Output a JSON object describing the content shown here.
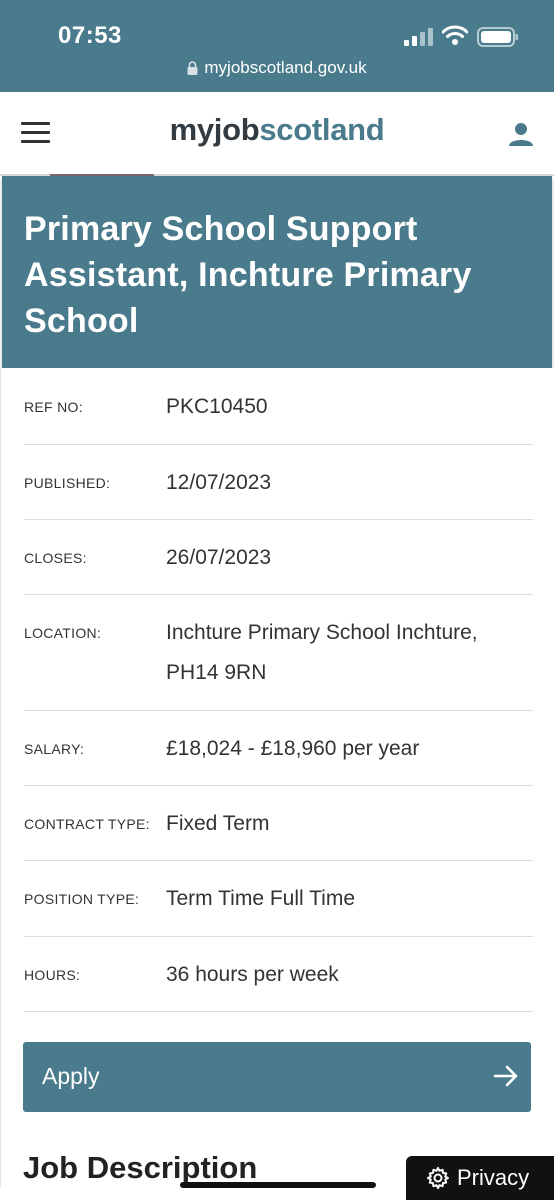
{
  "status_bar": {
    "time": "07:53"
  },
  "browser": {
    "url": "myjobscotland.gov.uk"
  },
  "header": {
    "logo_part1": "myjob",
    "logo_part2": "scotland"
  },
  "job": {
    "title": "Primary School Support Assistant, Inchture Primary School",
    "details": [
      {
        "label": "REF NO:",
        "value": "PKC10450"
      },
      {
        "label": "PUBLISHED:",
        "value": "12/07/2023"
      },
      {
        "label": "CLOSES:",
        "value": "26/07/2023"
      },
      {
        "label": "LOCATION:",
        "value_line1": "Inchture Primary School Inchture,",
        "value_line2": "PH14 9RN"
      },
      {
        "label": "SALARY:",
        "value": "£18,024 - £18,960 per year"
      },
      {
        "label": "CONTRACT TYPE:",
        "value": "Fixed Term"
      },
      {
        "label": "POSITION TYPE:",
        "value": "Term Time Full Time"
      },
      {
        "label": "HOURS:",
        "value": "36 hours per week"
      }
    ]
  },
  "actions": {
    "apply_label": "Apply"
  },
  "section": {
    "job_description_heading": "Job Description"
  },
  "privacy": {
    "label": "Privacy"
  },
  "colors": {
    "brand": "#4a7b8c",
    "text": "#333333"
  },
  "icons": [
    "lock-icon",
    "signal-icon",
    "wifi-icon",
    "battery-icon",
    "menu-icon",
    "user-icon",
    "arrow-right-icon",
    "gear-icon"
  ]
}
